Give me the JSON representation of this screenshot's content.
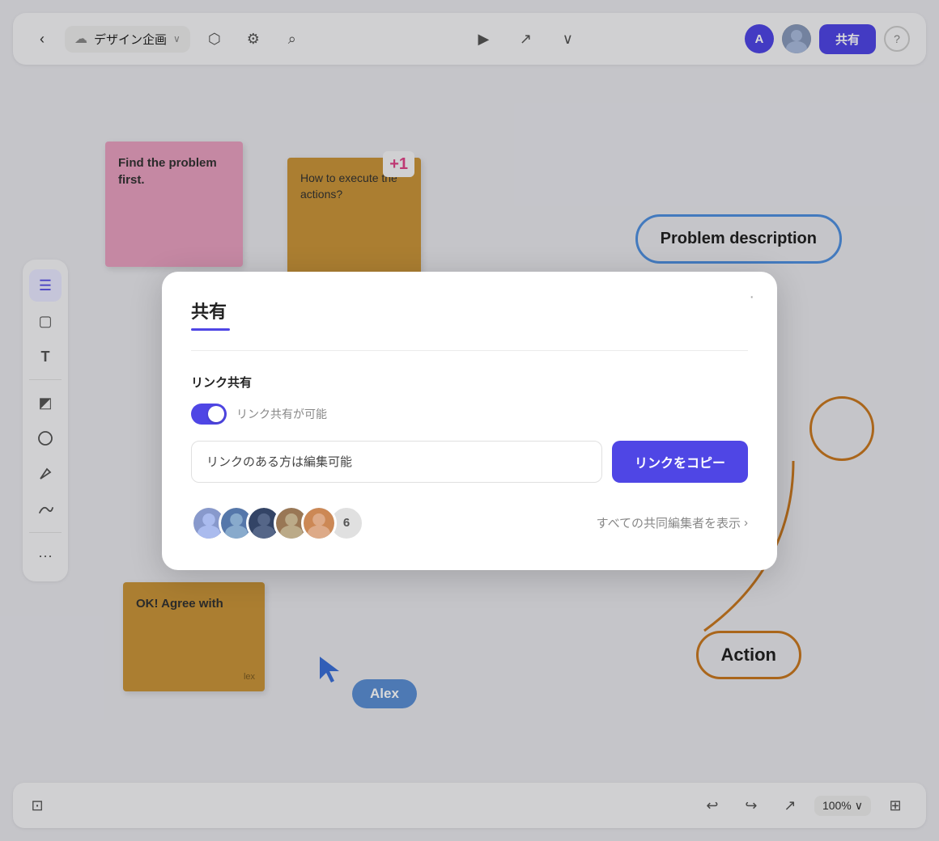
{
  "topbar": {
    "back_label": "‹",
    "project_name": "デザイン企画",
    "cloud_icon": "☁",
    "chevron": "∨",
    "tag_icon": "⬡",
    "settings_icon": "⚙",
    "search_icon": "⌕",
    "play_icon": "▶",
    "cursor_icon": "↗",
    "chevron_down_icon": "∨",
    "avatar_letter": "A",
    "share_label": "共有",
    "help_icon": "?"
  },
  "toolbar": {
    "tools": [
      {
        "name": "list-tool",
        "icon": "☰",
        "active": true
      },
      {
        "name": "frame-tool",
        "icon": "▢",
        "active": false
      },
      {
        "name": "text-tool",
        "icon": "T",
        "active": false
      },
      {
        "name": "sticky-tool",
        "icon": "◩",
        "active": false
      },
      {
        "name": "shape-tool",
        "icon": "⬡",
        "active": false
      },
      {
        "name": "pen-tool",
        "icon": "✏",
        "active": false
      },
      {
        "name": "draw-tool",
        "icon": "〜",
        "active": false
      },
      {
        "name": "more-tool",
        "icon": "···",
        "active": false
      }
    ]
  },
  "canvas": {
    "sticky_pink": {
      "text": "Find the problem first.",
      "color": "#d4789a"
    },
    "sticky_yellow_top": {
      "text": "How to execute the actions?",
      "badge": "+1",
      "color": "#c9953a"
    },
    "problem_bubble": {
      "text": "Problem description"
    },
    "sticky_yellow_bottom": {
      "text": "OK!\nAgree with",
      "author": "lex",
      "color": "#c9953a"
    },
    "action_bubble": {
      "text": "Action"
    },
    "alex_cursor_label": "Alex"
  },
  "modal": {
    "title": "共有",
    "link_sharing_label": "リンク共有",
    "toggle_label": "リンク共有が可能",
    "link_value": "リンクのある方は編集可能",
    "copy_btn_label": "リンクをコピー",
    "collaborators_count": "6",
    "view_all_label": "すべての共同編集者を表示",
    "view_all_chevron": "›"
  },
  "bottom_bar": {
    "undo_icon": "↩",
    "redo_icon": "↪",
    "pointer_icon": "↗",
    "zoom_label": "100%",
    "zoom_chevron": "∨",
    "map_icon": "⊞",
    "bottom_left_icon": "⊡"
  }
}
